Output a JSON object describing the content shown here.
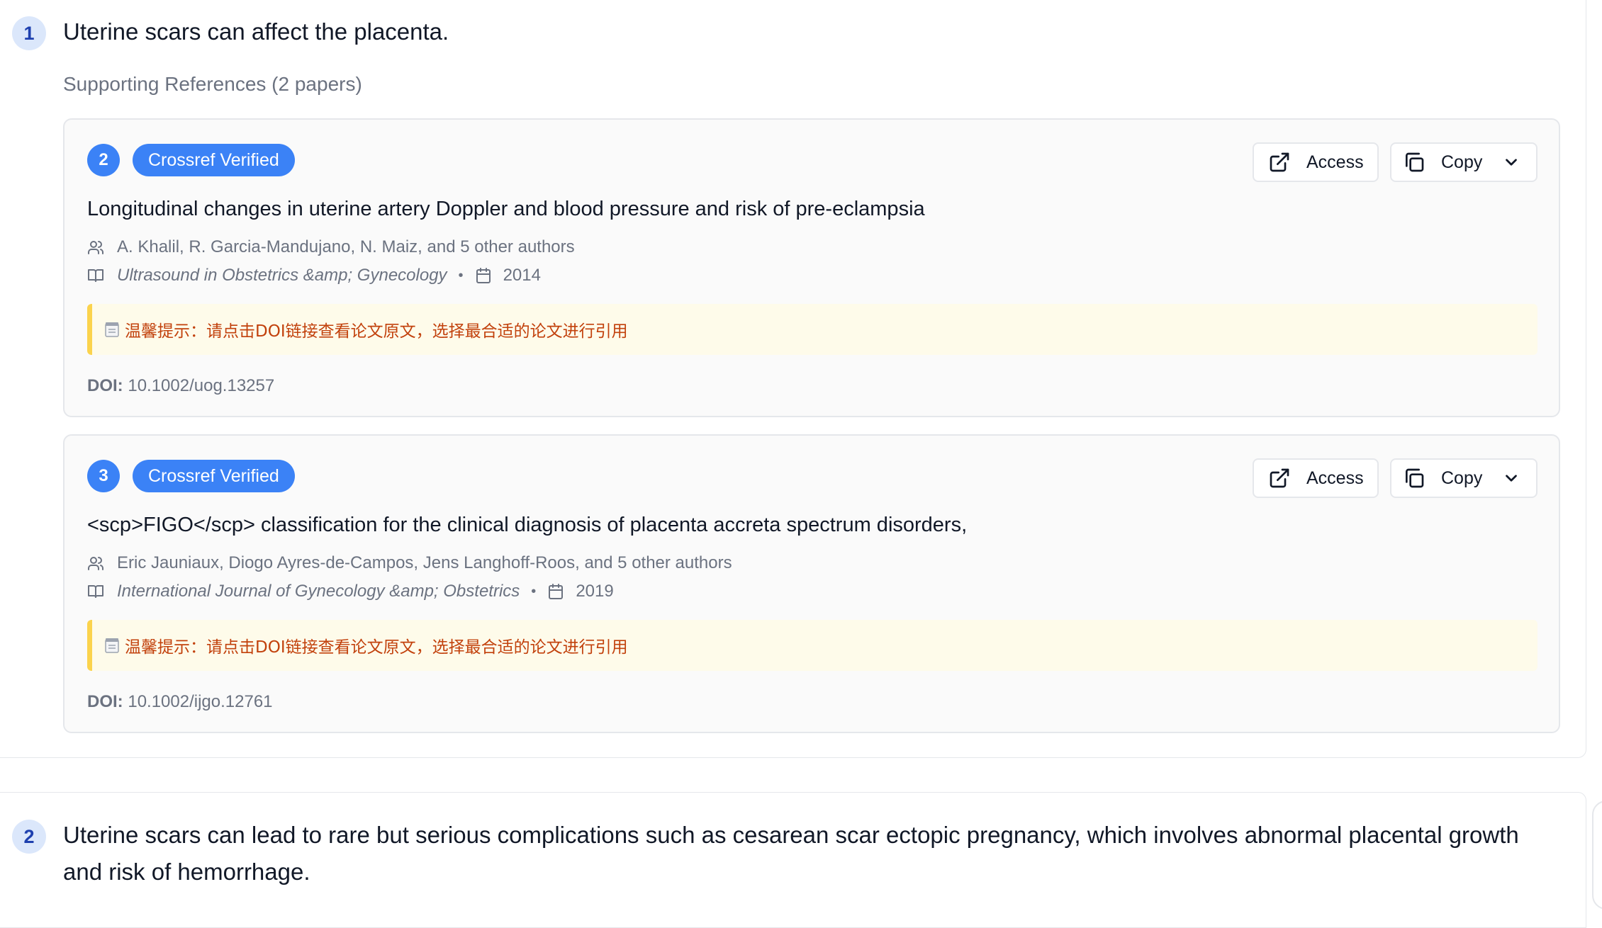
{
  "claims": [
    {
      "number": "1",
      "text": "Uterine scars can affect the placenta.",
      "references_heading": "Supporting References (2 papers)",
      "references": [
        {
          "index": "2",
          "badge": "Crossref Verified",
          "access_label": "Access",
          "copy_label": "Copy",
          "title": "Longitudinal changes in uterine artery Doppler and blood pressure and risk of pre-eclampsia",
          "authors": "A. Khalil, R. Garcia-Mandujano, N. Maiz, and 5 other authors",
          "journal": "Ultrasound in Obstetrics &amp; Gynecology",
          "year": "2014",
          "tip": "温馨提示：请点击DOI链接查看论文原文，选择最合适的论文进行引用",
          "doi_label": "DOI:",
          "doi": "10.1002/uog.13257"
        },
        {
          "index": "3",
          "badge": "Crossref Verified",
          "access_label": "Access",
          "copy_label": "Copy",
          "title": "<scp>FIGO</scp> classification for the clinical diagnosis of placenta accreta spectrum disorders,",
          "authors": "Eric Jauniaux, Diogo Ayres-de-Campos, Jens Langhoff-Roos, and 5 other authors",
          "journal": "International Journal of Gynecology &amp; Obstetrics",
          "year": "2019",
          "tip": "温馨提示：请点击DOI链接查看论文原文，选择最合适的论文进行引用",
          "doi_label": "DOI:",
          "doi": "10.1002/ijgo.12761"
        }
      ]
    },
    {
      "number": "2",
      "text": "Uterine scars can lead to rare but serious complications such as cesarean scar ectopic pregnancy, which involves abnormal placental growth and risk of hemorrhage."
    }
  ],
  "colors": {
    "accent": "#3b82f6",
    "claim_badge_bg": "#dbe7fb",
    "tip_text": "#c2410c",
    "tip_border": "#fbd34d"
  },
  "icons": {
    "access": "external-link-icon",
    "copy": "copy-icon",
    "dropdown": "chevron-down-icon",
    "authors": "users-icon",
    "journal": "book-icon",
    "date": "calendar-icon",
    "tip": "notepad-icon"
  }
}
